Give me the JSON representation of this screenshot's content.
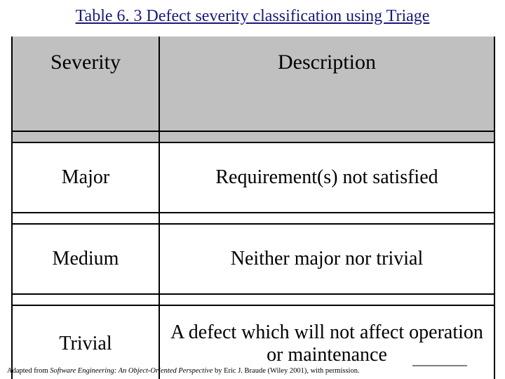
{
  "title": "Table 6. 3 Defect severity classification using Triage",
  "chart_data": {
    "type": "table",
    "title": "Table 6. 3 Defect severity classification using Triage",
    "columns": [
      "Severity",
      "Description"
    ],
    "rows": [
      {
        "severity": "Major",
        "description": "Requirement(s) not satisfied"
      },
      {
        "severity": "Medium",
        "description": "Neither major nor trivial"
      },
      {
        "severity": "Trivial",
        "description": "A defect which will not affect operation or maintenance"
      }
    ]
  },
  "table": {
    "headers": {
      "col1": "Severity",
      "col2": "Description"
    },
    "rows": [
      {
        "col1": "Major",
        "col2": "Requirement(s) not satisfied"
      },
      {
        "col1": "Medium",
        "col2": "Neither major nor trivial"
      },
      {
        "col1": "Trivial",
        "col2": "A defect which will not affect operation or maintenance"
      }
    ]
  },
  "attribution": {
    "prefix": "Adapted from ",
    "book": "Software Engineering: An Object-Oriented Perspective",
    "suffix": " by Eric J. Braude (Wiley 2001), with permission."
  }
}
